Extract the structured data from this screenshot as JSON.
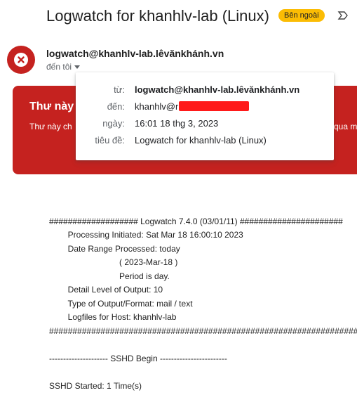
{
  "header": {
    "subject": "Logwatch for khanhlv-lab (Linux)",
    "badge": "Bên ngoài"
  },
  "sender": {
    "name": "logwatch@khanhlv-lab.lêvănkhánh.vn",
    "to_me": "đến tôi"
  },
  "warning": {
    "title": "Thư này c",
    "text": "Thư này ch",
    "text_right": "qua mọ"
  },
  "details_popup": {
    "from_label": "từ:",
    "from_value": "logwatch@khanhlv-lab.lêvănkhánh.vn",
    "to_label": "đến:",
    "to_value": "khanhlv@r",
    "date_label": "ngày:",
    "date_value": "16:01 18 thg 3, 2023",
    "subject_label": "tiêu đề:",
    "subject_value": "Logwatch for khanhlv-lab (Linux)"
  },
  "body": {
    "lines": [
      "################### Logwatch 7.4.0 (03/01/11) ######################",
      "        Processing Initiated: Sat Mar 18 16:00:10 2023",
      "        Date Range Processed: today",
      "                              ( 2023-Mar-18 )",
      "                              Period is day.",
      "        Detail Level of Output: 10",
      "        Type of Output/Format: mail / text",
      "        Logfiles for Host: khanhlv-lab",
      "###################################################################",
      "",
      "--------------------- SSHD Begin ------------------------",
      "",
      "SSHD Started: 1 Time(s)"
    ]
  },
  "colors": {
    "warning_bg": "#c5221f",
    "badge_bg": "#fbbc04",
    "redaction": "#ff1a1a"
  }
}
